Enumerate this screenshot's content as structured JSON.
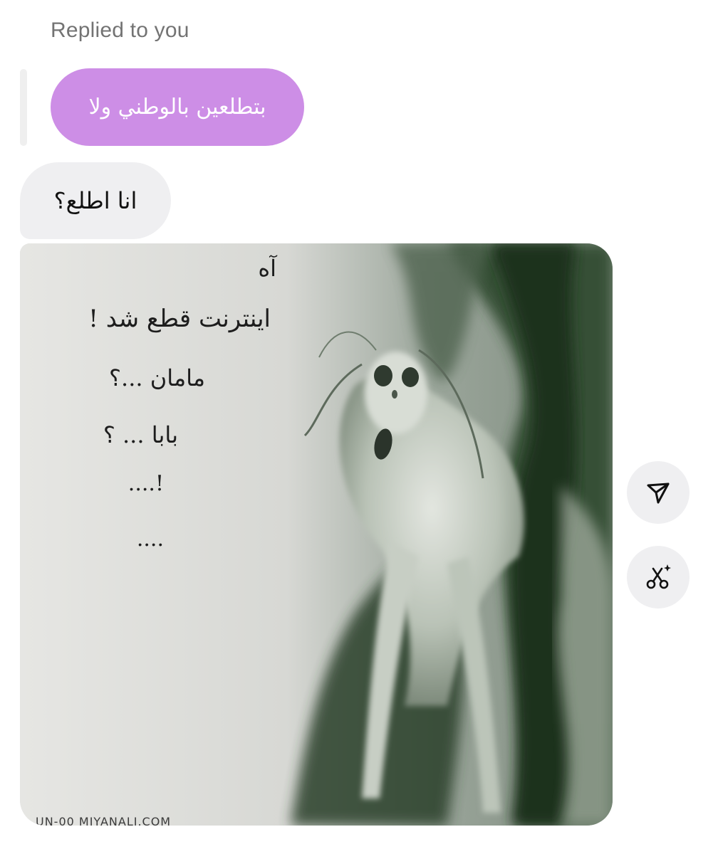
{
  "reply_header": "Replied to you",
  "quoted_message": "بتطلعين بالوطني ولا",
  "message": "انا اطلع؟",
  "image": {
    "meme_lines": [
      "آه",
      "اينترنت قطع شد !",
      "مامان ...؟",
      "بابا ... ؟",
      "!....",
      "...."
    ],
    "watermark": "UN-00 MIYANALI.COM"
  },
  "actions": {
    "share_icon": "send-icon",
    "remix_icon": "sparkle-scissors-icon"
  },
  "colors": {
    "quoted_bubble": "#cd8ee6",
    "message_bubble": "#efeff1",
    "reply_header_text": "#737373"
  }
}
